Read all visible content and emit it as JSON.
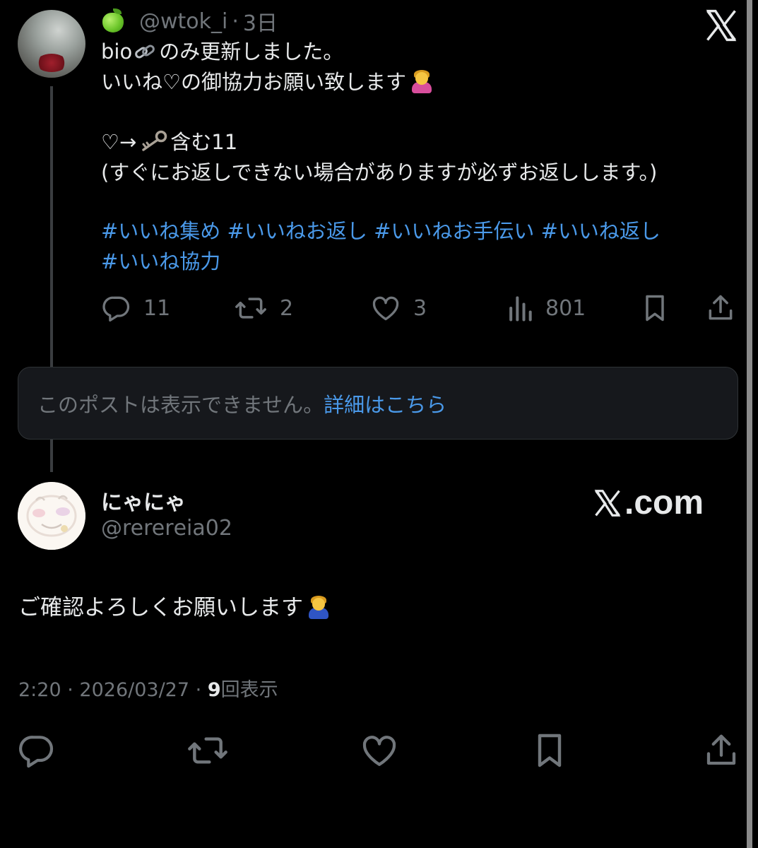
{
  "colors": {
    "background": "#000000",
    "text_primary": "#e7e9ea",
    "text_secondary": "#71767b",
    "accent_link": "#4a99e9",
    "notice_bg": "#16181c"
  },
  "post1": {
    "handle": "@wtok_i",
    "separator": "·",
    "time": "3日",
    "lines": {
      "l1_before": "bio",
      "l1_after": "のみ更新しました。",
      "l2": "いいね♡の御協力お願い致します",
      "l3_before": "♡→",
      "l3_after": "含む11",
      "l4": "(すぐにお返しできない場合がありますが必ずお返しします。)"
    },
    "hashtags": [
      "#いいね集め",
      "#いいねお返し",
      "#いいねお手伝い",
      "#いいね返し",
      "#いいね協力"
    ],
    "actions": {
      "replies": "11",
      "reposts": "2",
      "likes": "3",
      "views": "801"
    },
    "icons": [
      "apple-emoji",
      "link-icon",
      "bowing-person-emoji",
      "key-icon",
      "x-logo-icon"
    ]
  },
  "notice": {
    "text": "このポストは表示できません。",
    "link": "詳細はこちら"
  },
  "post2": {
    "display_name": "にゃにゃ",
    "handle": "@rererеia02",
    "brand": ".com",
    "text": "ご確認よろしくお願いします",
    "time": "2:20",
    "date": "2026/03/27",
    "sep": "·",
    "views_count": "9",
    "views_label": "回表示"
  }
}
